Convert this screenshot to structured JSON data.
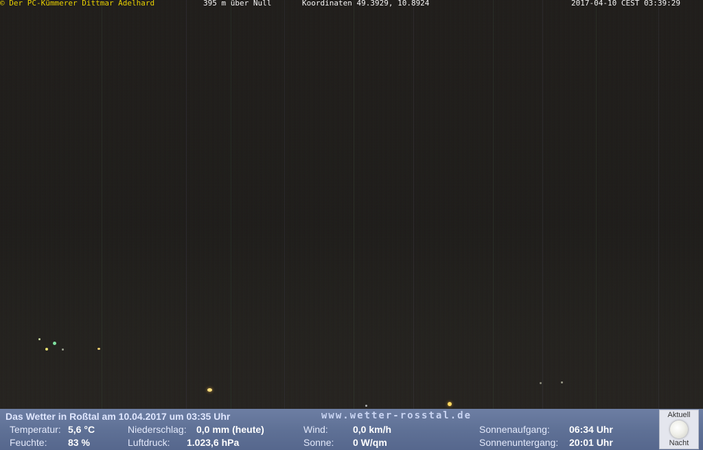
{
  "overlay": {
    "copyright": "© Der PC-Kümmerer Dittmar Adelhard",
    "altitude": "395 m über Null",
    "coordinates": "Koordinaten 49.3929, 10.8924",
    "datetime": "2017-04-10 CEST 03:39:29"
  },
  "weather": {
    "headline": "Das Wetter in Roßtal am 10.04.2017 um 03:35 Uhr",
    "url": "www.wetter-rosstal.de",
    "temperature_label": "Temperatur:",
    "temperature_value": "5,6 °C",
    "humidity_label": "Feuchte:",
    "humidity_value": "83 %",
    "precip_label": "Niederschlag:",
    "precip_value": "0,0 mm (heute)",
    "pressure_label": "Luftdruck:",
    "pressure_value": "1.023,6 hPa",
    "wind_label": "Wind:",
    "wind_value": "0,0 km/h",
    "sun_label": "Sonne:",
    "sun_value": "0 W/qm",
    "sunrise_label": "Sonnenaufgang:",
    "sunrise_value": "06:34 Uhr",
    "sunset_label": "Sonnenuntergang:",
    "sunset_value": "20:01 Uhr"
  },
  "moon": {
    "label_top": "Aktuell",
    "label_bottom": "Nacht",
    "icon": "moon-icon"
  },
  "colors": {
    "panel": "#5f7196",
    "copyright": "#e8d000",
    "sky": "#1e1c19"
  }
}
